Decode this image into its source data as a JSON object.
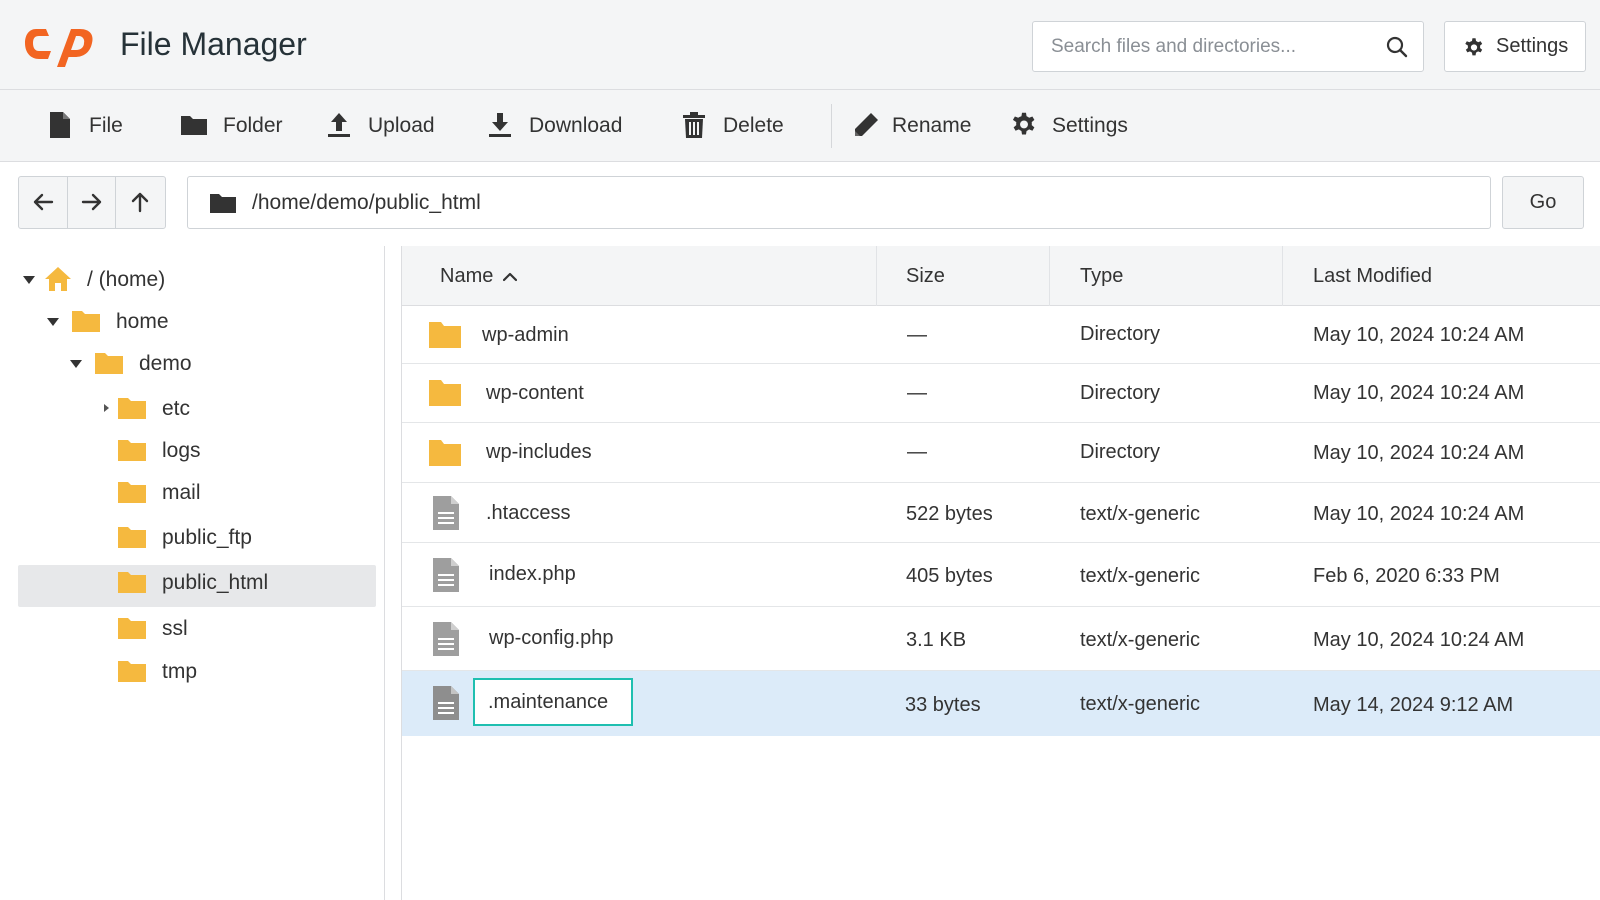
{
  "header": {
    "title": "File Manager",
    "logo_icon": "cpanel-logo-icon",
    "search_placeholder": "Search files and directories...",
    "settings_label": "Settings"
  },
  "toolbar": {
    "file": "File",
    "folder": "Folder",
    "upload": "Upload",
    "download": "Download",
    "delete": "Delete",
    "rename": "Rename",
    "settings": "Settings"
  },
  "pathbar": {
    "path": "/home/demo/public_html",
    "go": "Go"
  },
  "tree": {
    "root": "/ (home)",
    "home": "home",
    "demo": "demo",
    "children": [
      "etc",
      "logs",
      "mail",
      "public_ftp",
      "public_html",
      "ssl",
      "tmp"
    ],
    "selected": "public_html"
  },
  "table": {
    "columns": [
      "Name",
      "Size",
      "Type",
      "Last Modified"
    ],
    "sort_column": "Name",
    "sort_direction": "ascending",
    "rows": [
      {
        "name": "wp-admin",
        "size": "—",
        "type": "Directory",
        "modified": "May 10, 2024 10:24 AM",
        "icon": "folder-icon"
      },
      {
        "name": "wp-content",
        "size": "—",
        "type": "Directory",
        "modified": "May 10, 2024 10:24 AM",
        "icon": "folder-icon"
      },
      {
        "name": "wp-includes",
        "size": "—",
        "type": "Directory",
        "modified": "May 10, 2024 10:24 AM",
        "icon": "folder-icon"
      },
      {
        "name": ".htaccess",
        "size": "522 bytes",
        "type": "text/x-generic",
        "modified": "May 10, 2024 10:24 AM",
        "icon": "file-icon"
      },
      {
        "name": "index.php",
        "size": "405 bytes",
        "type": "text/x-generic",
        "modified": "Feb 6, 2020 6:33 PM",
        "icon": "file-icon"
      },
      {
        "name": "wp-config.php",
        "size": "3.1 KB",
        "type": "text/x-generic",
        "modified": "May 10, 2024 10:24 AM",
        "icon": "file-icon"
      },
      {
        "name": ".maintenance",
        "size": "33 bytes",
        "type": "text/x-generic",
        "modified": "May 14, 2024 9:12 AM",
        "icon": "file-icon",
        "selected": true,
        "editing": true
      }
    ]
  },
  "colors": {
    "accent_logo": "#f26522",
    "folder": "#f5b93f",
    "selection_row": "#dcebf9",
    "edit_border": "#1fbfb0"
  }
}
